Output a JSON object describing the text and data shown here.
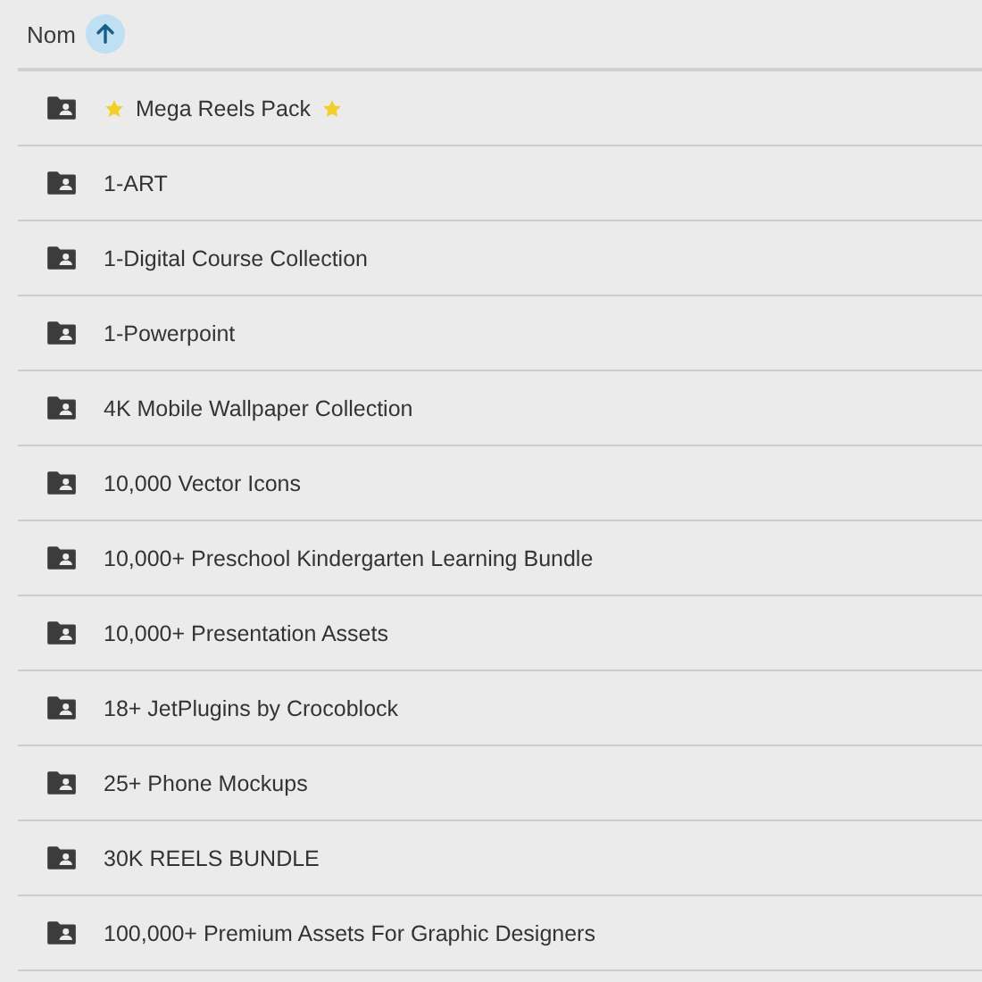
{
  "header": {
    "label": "Nom",
    "ascending": true
  },
  "rows": [
    {
      "name": "Mega Reels Pack",
      "starred": true
    },
    {
      "name": "1-ART",
      "starred": false
    },
    {
      "name": "1-Digital Course Collection",
      "starred": false
    },
    {
      "name": "1-Powerpoint",
      "starred": false
    },
    {
      "name": "4K Mobile Wallpaper Collection",
      "starred": false
    },
    {
      "name": "10,000  Vector Icons",
      "starred": false
    },
    {
      "name": "10,000+ Preschool Kindergarten Learning Bundle",
      "starred": false
    },
    {
      "name": "10,000+ Presentation Assets",
      "starred": false
    },
    {
      "name": "18+ JetPlugins by Crocoblock",
      "starred": false
    },
    {
      "name": "25+ Phone Mockups",
      "starred": false
    },
    {
      "name": "30K REELS BUNDLE",
      "starred": false
    },
    {
      "name": "100,000+ Premium Assets For Graphic Designers",
      "starred": false
    }
  ]
}
